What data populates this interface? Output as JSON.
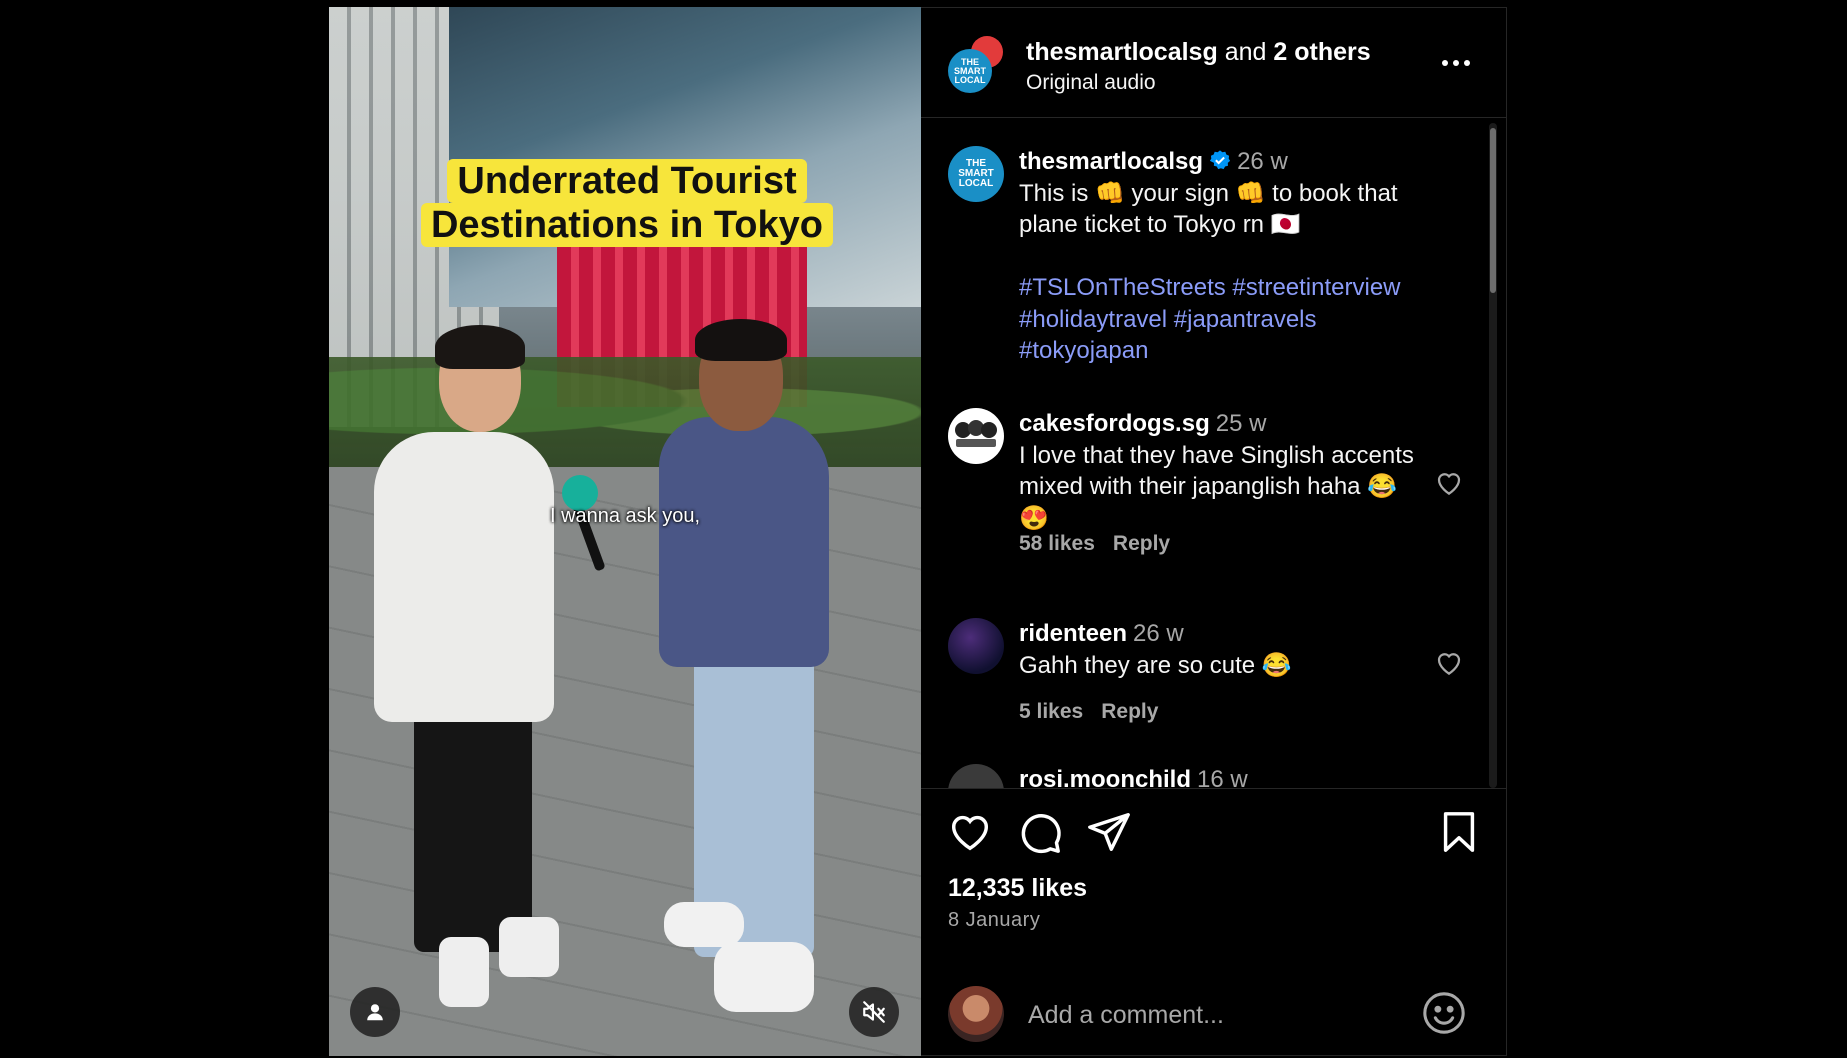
{
  "video": {
    "title_line1": "Underrated Tourist",
    "title_line2": "Destinations in Tokyo",
    "subtitle": "I wanna ask you,"
  },
  "header": {
    "username": "thesmartlocalsg",
    "and_text": "and",
    "others": "2 others",
    "audio": "Original audio",
    "avatar_text": "THE\nSMART\nLOCAL"
  },
  "caption": {
    "username": "thesmartlocalsg",
    "time": "26 w",
    "text_line1": "This is 👊 your sign 👊 to book that",
    "text_line2": "plane ticket to Tokyo rn 🇯🇵",
    "hashtags_line1": "#TSLOnTheStreets #streetinterview",
    "hashtags_line2": "#holidaytravel #japantravels",
    "hashtags_line3": "#tokyojapan"
  },
  "comments": [
    {
      "username": "cakesfordogs.sg",
      "time": "25 w",
      "text": "I love that they have Singlish accents mixed with their japanglish haha 😂😍",
      "likes": "58 likes",
      "reply": "Reply"
    },
    {
      "username": "ridenteen",
      "time": "26 w",
      "text": "Gahh they are so cute 😂",
      "likes": "5 likes",
      "reply": "Reply"
    },
    {
      "username": "rosi.moonchild",
      "time": "16 w"
    }
  ],
  "post": {
    "likes": "12,335 likes",
    "date": "8 January"
  },
  "add_comment": {
    "placeholder": "Add a comment..."
  },
  "colors": {
    "hashtag": "#8b9cf8",
    "banner": "#f7e53b",
    "verified": "#0095f6"
  }
}
